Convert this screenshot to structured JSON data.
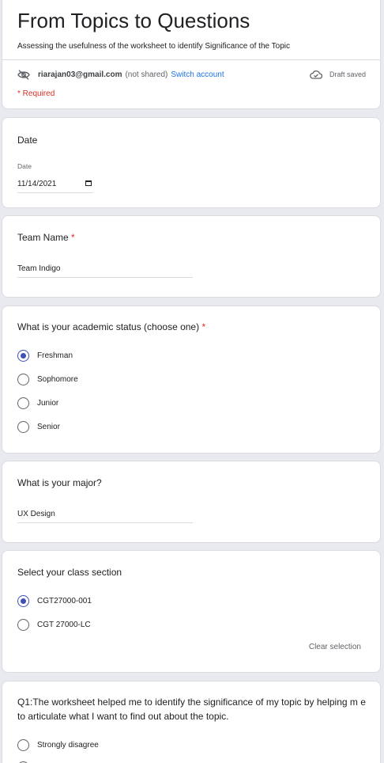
{
  "header": {
    "title": "From Topics to Questions",
    "description": "Assessing the usefulness of the worksheet to identify Significance of the Topic",
    "account_email": "riarajan03@gmail.com",
    "not_shared": "(not shared)",
    "switch_account": "Switch account",
    "draft_status": "Draft saved",
    "required_note": "* Required"
  },
  "date_question": {
    "title": "Date",
    "sub_label": "Date",
    "value": "11/14/2021"
  },
  "team_question": {
    "title": "Team Name",
    "required_mark": "*",
    "value": "Team Indigo"
  },
  "status_question": {
    "title": "What is your academic status (choose one)",
    "required_mark": "*",
    "options": [
      "Freshman",
      "Sophomore",
      "Junior",
      "Senior"
    ],
    "selected": "Freshman"
  },
  "major_question": {
    "title": "What is your major?",
    "value": "UX Design"
  },
  "section_question": {
    "title": "Select your class section",
    "options": [
      "CGT27000-001",
      "CGT 27000-LC"
    ],
    "selected": "CGT27000-001",
    "clear_label": "Clear selection"
  },
  "q1_question": {
    "title": "Q1:The worksheet helped me to identify the significance of my topic by helping m e to articulate what I want to find out about the topic.",
    "options": [
      "Strongly disagree"
    ]
  },
  "colors": {
    "accent": "#3f51b5",
    "required": "#d93025",
    "link": "#1a73e8",
    "background": "#e8eaf0"
  },
  "icons": {
    "not_shared": "eye-off-icon",
    "draft": "cloud-done-icon",
    "calendar": "calendar-icon"
  }
}
